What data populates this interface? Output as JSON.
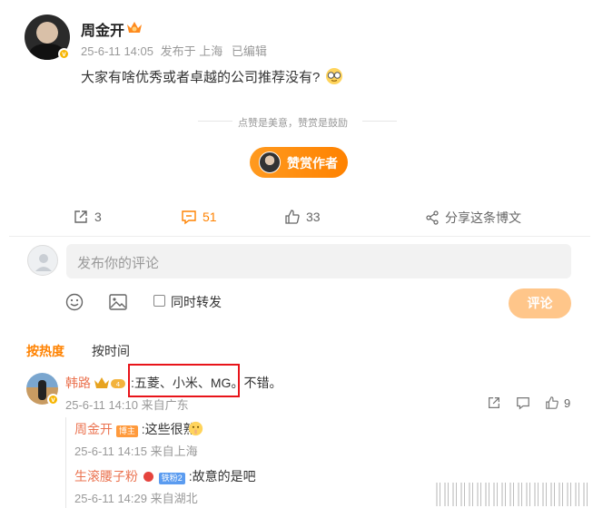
{
  "post": {
    "author": "周金开",
    "time": "25-6-11 14:05",
    "location": "发布于 上海",
    "edited": "已编辑",
    "text": "大家有啥优秀或者卓越的公司推荐没有?"
  },
  "reward": {
    "hint": "点赞是美意，赞赏是鼓励",
    "button": "赞赏作者"
  },
  "actions": {
    "share_count": "3",
    "comment_count": "51",
    "like_count": "33",
    "share_long": "分享这条博文"
  },
  "composer": {
    "placeholder": "发布你的评论",
    "repost_label": "同时转发",
    "submit": "评论"
  },
  "sort_tabs": {
    "hot": "按热度",
    "time": "按时间"
  },
  "comments": [
    {
      "user": "韩路",
      "text": ":五菱、小米、MG。不错。",
      "time": "25-6-11 14:10 来自广东",
      "likes": "9",
      "replies": [
        {
          "user": "周金开",
          "tag": "博主",
          "text": ":这些很熟",
          "time": "25-6-11 14:15 来自上海"
        },
        {
          "user": "生滚腰子粉",
          "tag": "铁粉2",
          "text": ":故意的是吧",
          "time": "25-6-11 14:29 来自湖北"
        }
      ]
    }
  ],
  "colors": {
    "accent_orange": "#ff8200",
    "username": "#eb7350",
    "highlight_red": "#e8141a"
  }
}
